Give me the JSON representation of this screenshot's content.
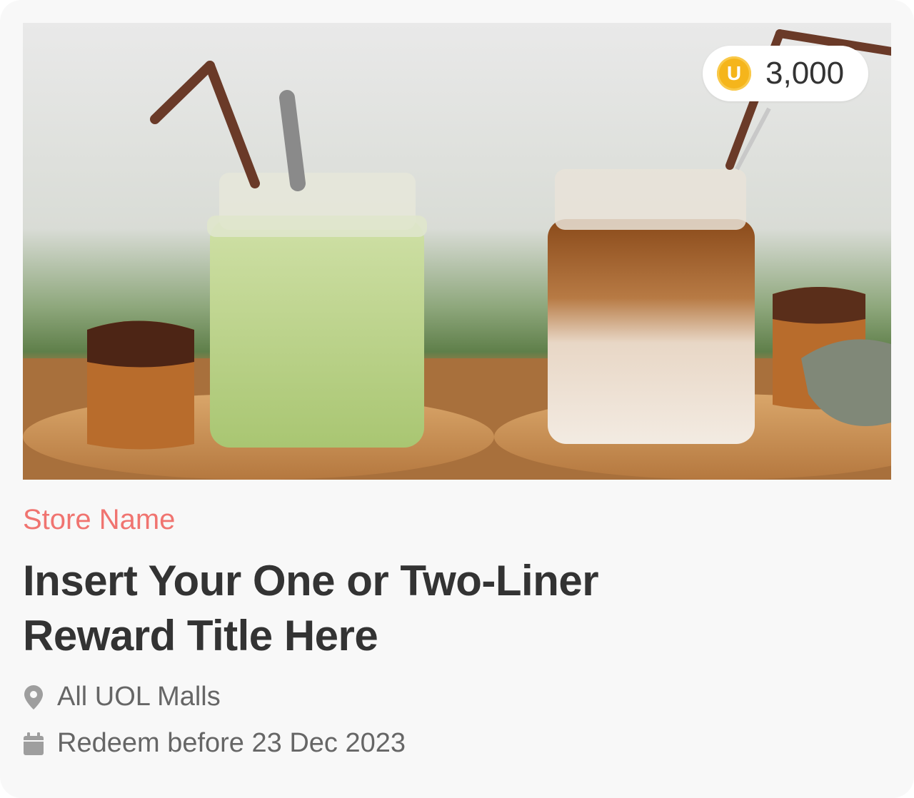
{
  "card": {
    "image_alt": "Matcha latte and iced coffee in glass jars",
    "points": {
      "coin_symbol": "U",
      "value": "3,000"
    },
    "store_name": "Store Name",
    "title": "Insert Your One or Two-Liner Reward Title Here",
    "location": {
      "icon": "location-pin-icon",
      "text": "All UOL Malls"
    },
    "expiry": {
      "icon": "calendar-icon",
      "text": "Redeem before 23 Dec 2023"
    }
  },
  "colors": {
    "store_name": "#f07470",
    "title": "#333333",
    "meta_text": "#666666",
    "coin": "#f5b51b",
    "card_bg": "#f8f8f8"
  }
}
